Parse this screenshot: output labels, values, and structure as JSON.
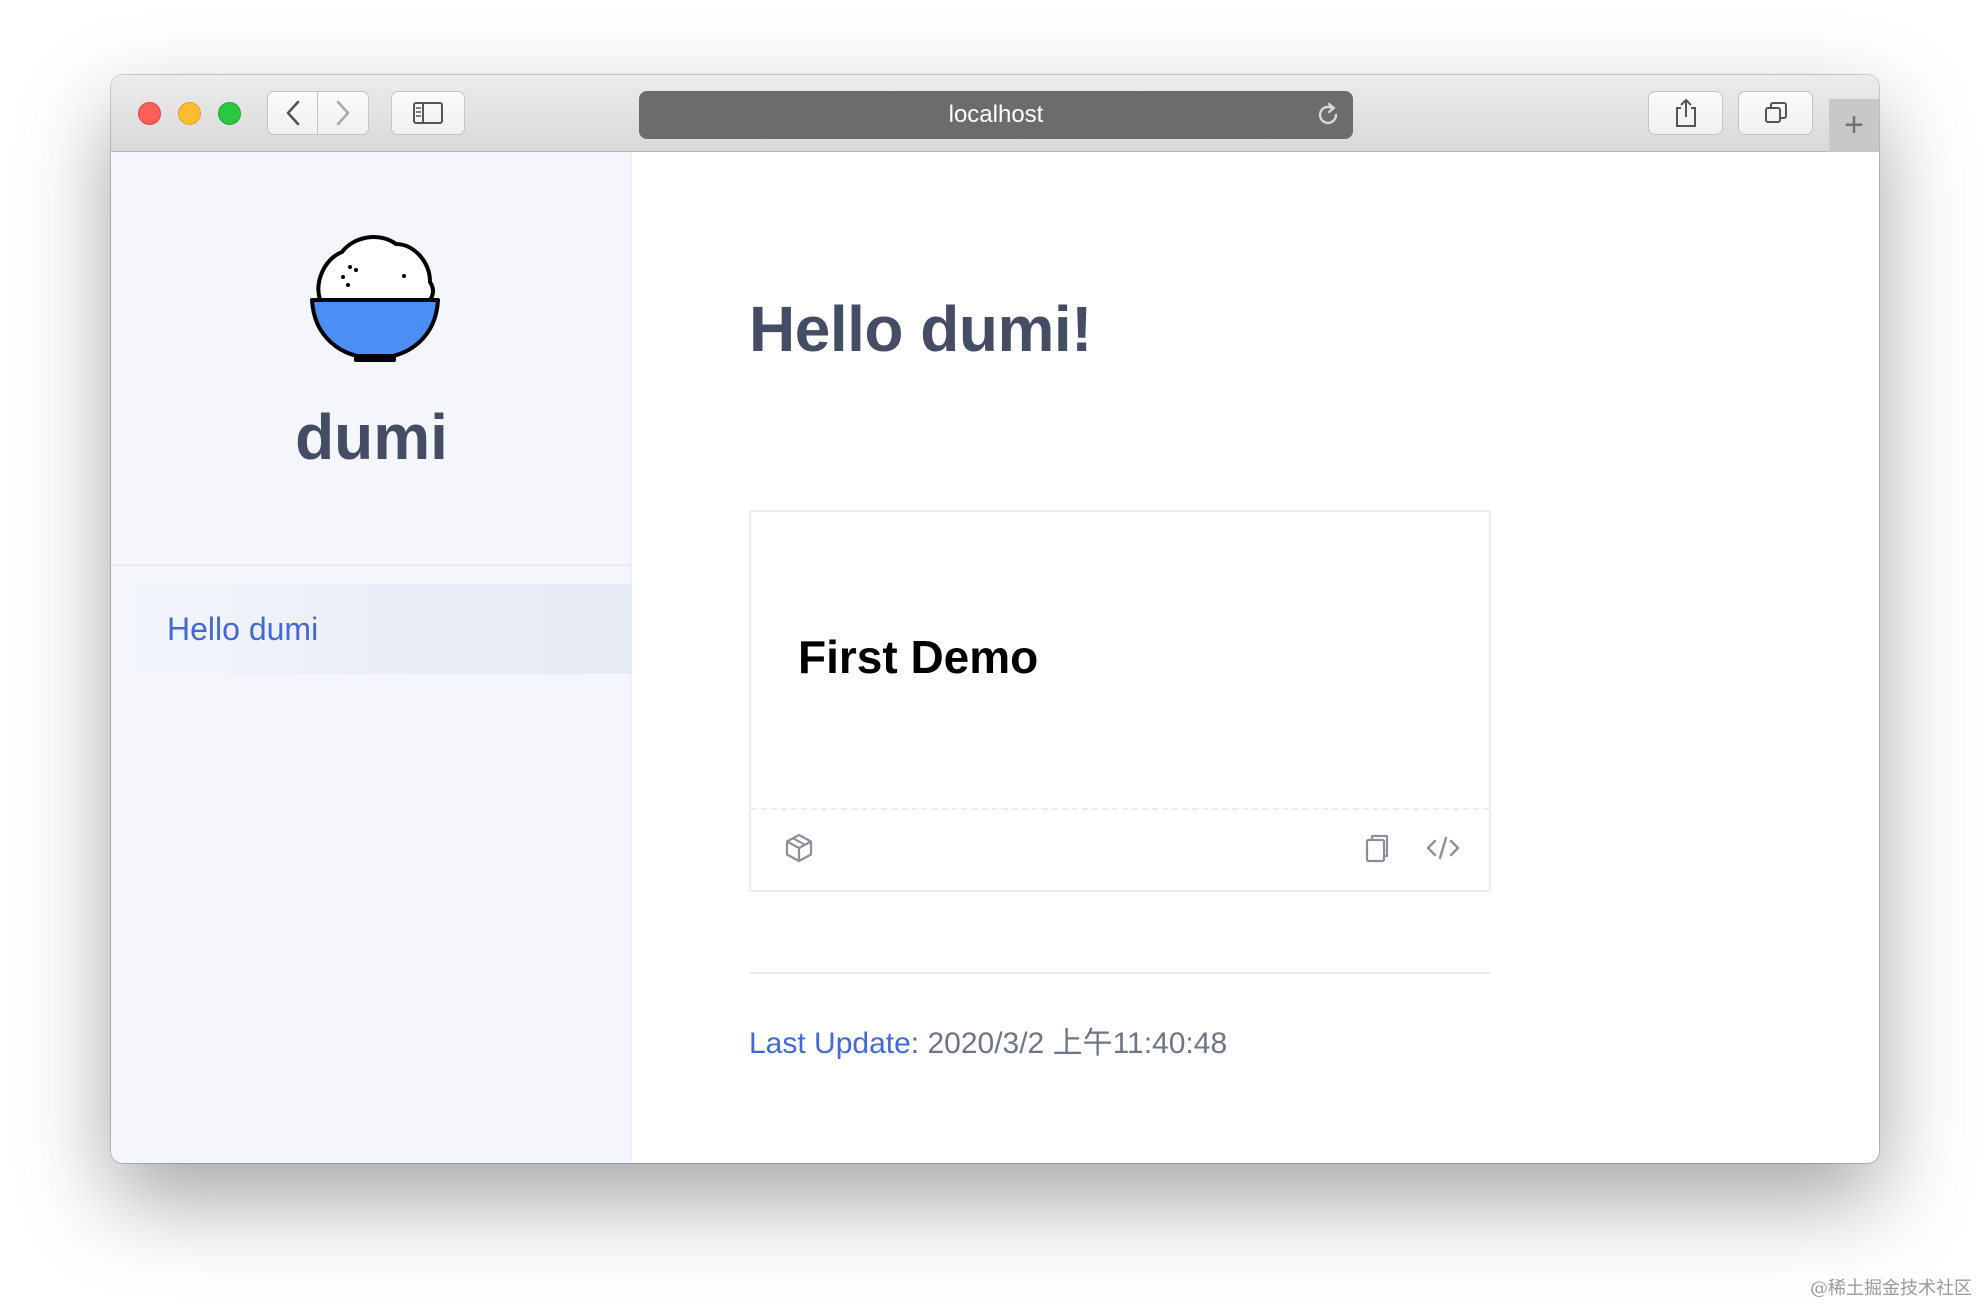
{
  "browser": {
    "url": "localhost",
    "new_tab_label": "+"
  },
  "sidebar": {
    "site_name": "dumi",
    "nav_items": [
      {
        "label": "Hello dumi",
        "active": true
      }
    ]
  },
  "main": {
    "title": "Hello dumi!",
    "demo": {
      "title": "First Demo",
      "actions": [
        "codesandbox-icon",
        "copy-icon",
        "code-icon"
      ]
    },
    "last_update": {
      "label": "Last Update:",
      "value": "2020/3/2 上午11:40:48"
    }
  },
  "watermark": "@稀土掘金技术社区",
  "colors": {
    "accent": "#4569d4",
    "heading": "#454d64",
    "sidebar_bg": "#f4f6fc",
    "logo_bowl": "#4b8ef5"
  }
}
